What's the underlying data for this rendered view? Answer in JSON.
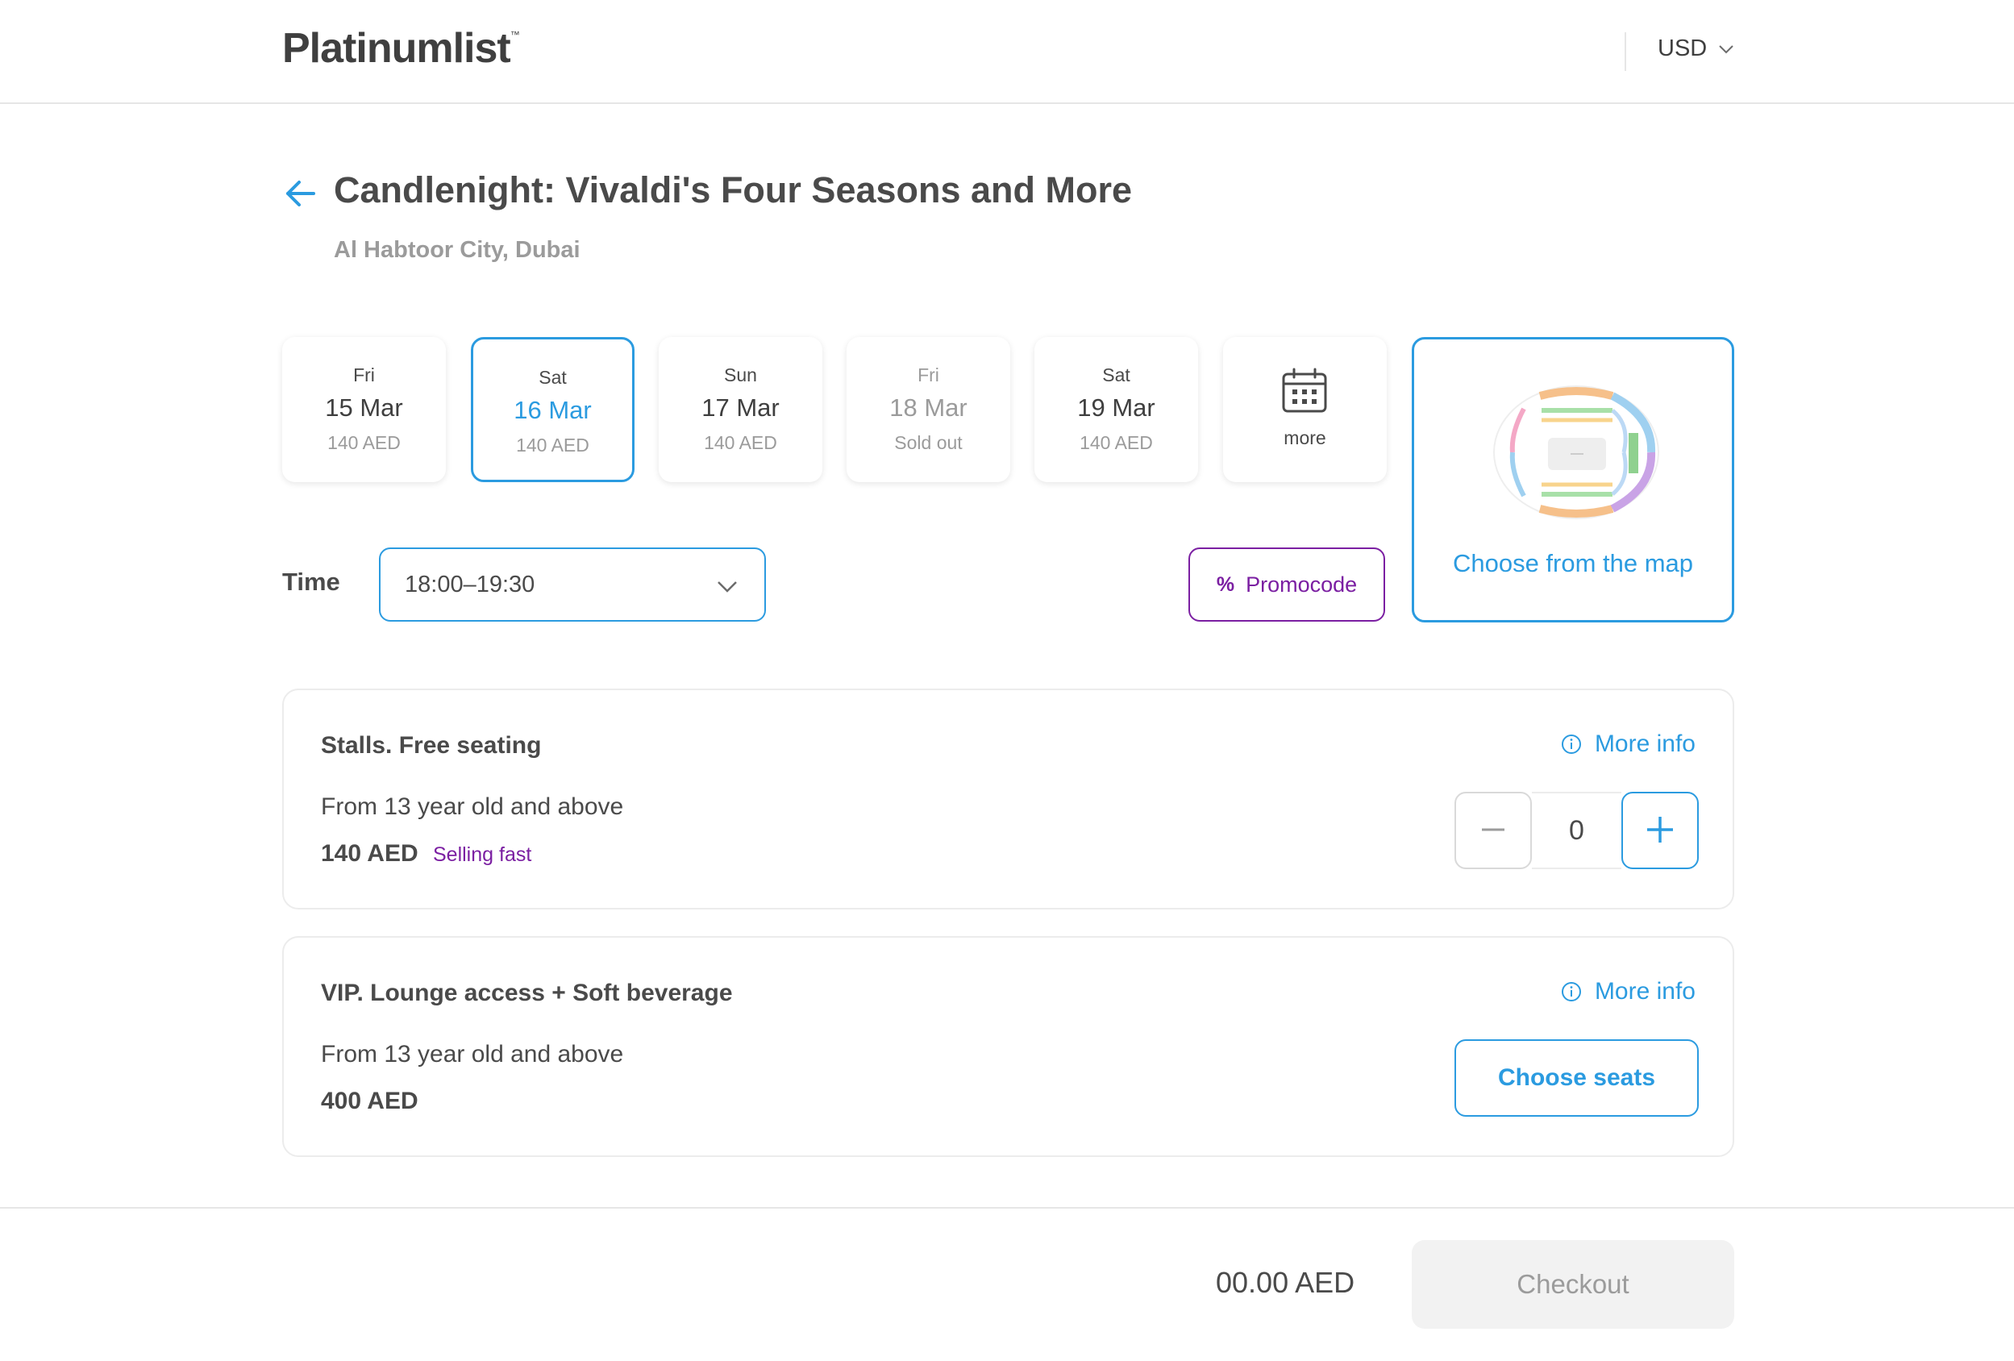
{
  "header": {
    "logo": "Platinumlist",
    "currency": "USD"
  },
  "event": {
    "title": "Candlenight: Vivaldi's Four Seasons and More",
    "venue": "Al Habtoor City, Dubai"
  },
  "dates": [
    {
      "dow": "Fri",
      "day": "15 Mar",
      "price": "140 AED"
    },
    {
      "dow": "Sat",
      "day": "16 Mar",
      "price": "140 AED"
    },
    {
      "dow": "Sun",
      "day": "17 Mar",
      "price": "140 AED"
    },
    {
      "dow": "Fri",
      "day": "18 Mar",
      "price": "Sold out"
    },
    {
      "dow": "Sat",
      "day": "19 Mar",
      "price": "140 AED"
    }
  ],
  "more_dates_label": "more",
  "map": {
    "label": "Choose from the map"
  },
  "time": {
    "label": "Time",
    "value": "18:00–19:30"
  },
  "promo": {
    "icon": "%",
    "label": "Promocode"
  },
  "tickets": [
    {
      "name": "Stalls. Free seating",
      "desc": "From 13 year old and above",
      "price": "140 AED",
      "tag": "Selling fast",
      "more_info": "More info",
      "quantity": "0"
    },
    {
      "name": "VIP. Lounge access + Soft beverage",
      "desc": "From 13 year old and above",
      "price": "400 AED",
      "more_info": "More info",
      "action": "Choose seats"
    }
  ],
  "footer": {
    "total": "00.00 AED",
    "checkout": "Checkout"
  },
  "colors": {
    "accent": "#2b9be0",
    "promo": "#7b1fa2",
    "text": "#4a4a4a",
    "muted": "#9b9b9b"
  }
}
